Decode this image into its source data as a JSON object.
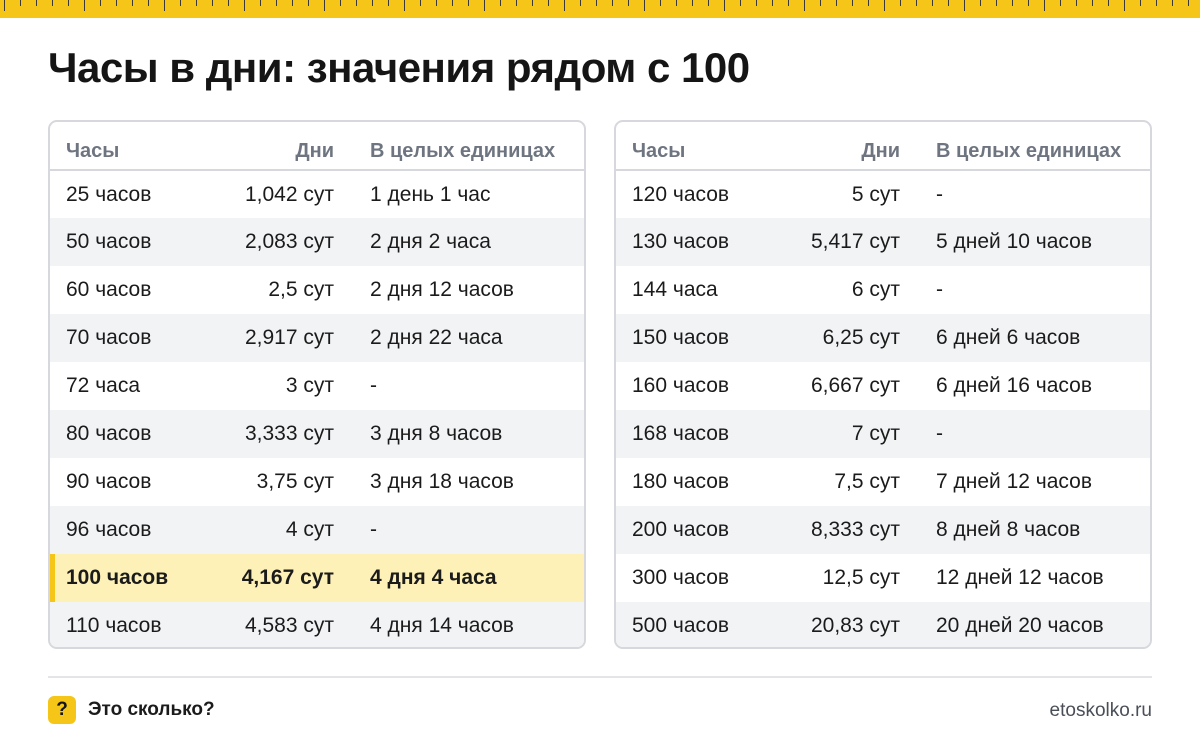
{
  "title": "Часы в дни: значения рядом с 100",
  "colors": {
    "accent": "#f5c518",
    "highlight_row": "#fdf1b7",
    "stripe_row": "#f2f3f5",
    "header_text": "#6f7580"
  },
  "headers": {
    "hours": "Часы",
    "days": "Дни",
    "whole": "В целых единицах"
  },
  "left_table": [
    {
      "hours": "25 часов",
      "days": "1,042 сут",
      "whole": "1 день 1 час"
    },
    {
      "hours": "50 часов",
      "days": "2,083 сут",
      "whole": "2 дня 2 часа"
    },
    {
      "hours": "60 часов",
      "days": "2,5 сут",
      "whole": "2 дня 12 часов"
    },
    {
      "hours": "70 часов",
      "days": "2,917 сут",
      "whole": "2 дня 22 часа"
    },
    {
      "hours": "72 часа",
      "days": "3 сут",
      "whole": "-"
    },
    {
      "hours": "80 часов",
      "days": "3,333 сут",
      "whole": "3 дня 8 часов"
    },
    {
      "hours": "90 часов",
      "days": "3,75 сут",
      "whole": "3 дня 18 часов"
    },
    {
      "hours": "96 часов",
      "days": "4 сут",
      "whole": "-"
    },
    {
      "hours": "100 часов",
      "days": "4,167 сут",
      "whole": "4 дня 4 часа",
      "highlighted": true
    },
    {
      "hours": "110 часов",
      "days": "4,583 сут",
      "whole": "4 дня 14 часов"
    }
  ],
  "right_table": [
    {
      "hours": "120 часов",
      "days": "5 сут",
      "whole": "-"
    },
    {
      "hours": "130 часов",
      "days": "5,417 сут",
      "whole": "5 дней 10 часов"
    },
    {
      "hours": "144 часа",
      "days": "6 сут",
      "whole": "-"
    },
    {
      "hours": "150 часов",
      "days": "6,25 сут",
      "whole": "6 дней 6 часов"
    },
    {
      "hours": "160 часов",
      "days": "6,667 сут",
      "whole": "6 дней 16 часов"
    },
    {
      "hours": "168 часов",
      "days": "7 сут",
      "whole": "-"
    },
    {
      "hours": "180 часов",
      "days": "7,5 сут",
      "whole": "7 дней 12 часов"
    },
    {
      "hours": "200 часов",
      "days": "8,333 сут",
      "whole": "8 дней 8 часов"
    },
    {
      "hours": "300 часов",
      "days": "12,5 сут",
      "whole": "12 дней 12 часов"
    },
    {
      "hours": "500 часов",
      "days": "20,83 сут",
      "whole": "20 дней 20 часов"
    }
  ],
  "footer": {
    "icon_glyph": "?",
    "brand": "Это сколько?",
    "site": "etoskolko.ru"
  }
}
